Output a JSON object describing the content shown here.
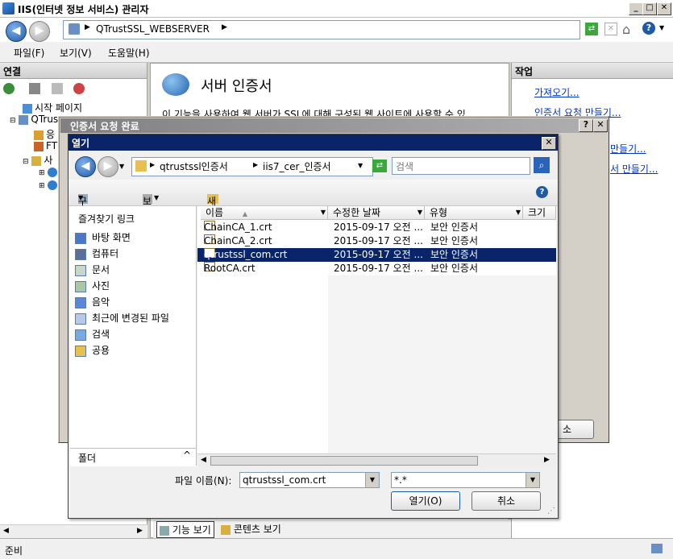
{
  "window": {
    "title": "IIS(인터넷 정보 서비스) 관리자"
  },
  "address": {
    "path": "QTrustSSL_WEBSERVER"
  },
  "menu": {
    "items": [
      "파일(F)",
      "보기(V)",
      "도움말(H)"
    ]
  },
  "left": {
    "header": "연결",
    "tree": [
      "시작 페이지",
      "QTrus",
      "응",
      "FT",
      "사"
    ]
  },
  "center": {
    "title": "서버 인증서",
    "description": "이 기능을 사용하여 웹 서버가 SSL에 대해 구성된 웹 사이트에 사용할 수 있",
    "views": [
      "기능 보기",
      "콘텐츠 보기"
    ]
  },
  "right": {
    "header": "작업",
    "actions": [
      "가져오기...",
      "인증서 요청 만들기...",
      "...",
      "만들기...",
      "서 만들기..."
    ],
    "cutoff_button": "소"
  },
  "status": {
    "text": "준비"
  },
  "cert_dialog": {
    "title": "인증서 요청 완료"
  },
  "open_dialog": {
    "title": "열기",
    "breadcrumb": [
      "qtrustssl인증서",
      "iis7_cer_인증서"
    ],
    "search_placeholder": "검색",
    "toolbar": {
      "organize": "구성",
      "views": "보기",
      "new_folder": "새 폴더"
    },
    "favorites_header": "즐겨찾기 링크",
    "favorites": [
      "바탕 화면",
      "컴퓨터",
      "문서",
      "사진",
      "음악",
      "최근에 변경된 파일",
      "검색",
      "공용"
    ],
    "folders_label": "폴더",
    "columns": [
      "이름",
      "수정한 날짜",
      "유형",
      "크기"
    ],
    "files": [
      {
        "name": "ChainCA_1.crt",
        "date": "2015-09-17 오전 ...",
        "type": "보안 인증서",
        "selected": false
      },
      {
        "name": "ChainCA_2.crt",
        "date": "2015-09-17 오전 ...",
        "type": "보안 인증서",
        "selected": false
      },
      {
        "name": "qtrustssl_com.crt",
        "date": "2015-09-17 오전 ...",
        "type": "보안 인증서",
        "selected": true
      },
      {
        "name": "RootCA.crt",
        "date": "2015-09-17 오전 ...",
        "type": "보안 인증서",
        "selected": false
      }
    ],
    "filename_label": "파일 이름(N):",
    "filename_value": "qtrustssl_com.crt",
    "filetype_value": "*.*",
    "open_button": "열기(O)",
    "cancel_button": "취소"
  },
  "colors": {
    "selection": "#0a246a",
    "link": "#0033cc",
    "caption": "#0a246a"
  }
}
